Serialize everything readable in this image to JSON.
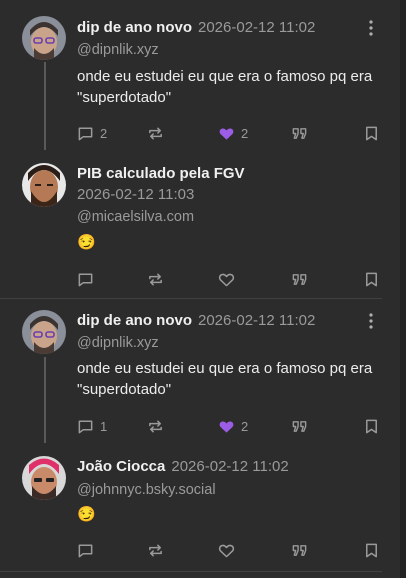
{
  "posts": [
    {
      "name": "dip de ano novo",
      "time": "2026-02-12 11:02",
      "handle": "@dipnlik.xyz",
      "text": "onde eu estudei eu que era o famoso pq era \"superdotado\"",
      "replies": "2",
      "likes": "2",
      "liked": true
    },
    {
      "name": "PIB calculado pela FGV",
      "time": "2026-02-12 11:03",
      "handle": "@micaelsilva.com",
      "text": "😏",
      "replies": "",
      "likes": "",
      "liked": false
    },
    {
      "name": "dip de ano novo",
      "time": "2026-02-12 11:02",
      "handle": "@dipnlik.xyz",
      "text": "onde eu estudei eu que era o famoso pq era \"superdotado\"",
      "replies": "1",
      "likes": "2",
      "liked": true
    },
    {
      "name": "João Ciocca",
      "time": "2026-02-12 11:02",
      "handle": "@johnnyc.bsky.social",
      "text": "😏",
      "replies": "",
      "likes": "",
      "liked": false
    }
  ],
  "colors": {
    "like_active": "#9b5de5",
    "muted": "#9a9a9a",
    "background": "#2c2c2c"
  },
  "icons": [
    "reply-icon",
    "repost-icon",
    "heart-icon",
    "quote-icon",
    "bookmark-icon",
    "more-icon"
  ]
}
